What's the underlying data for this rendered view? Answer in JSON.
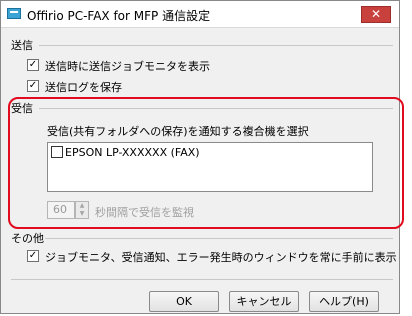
{
  "window": {
    "title": "Offirio PC-FAX for MFP 通信設定",
    "close_symbol": "✕"
  },
  "send_section": {
    "heading": "送信",
    "options": [
      {
        "label": "送信時に送信ジョブモニタを表示",
        "checked": true
      },
      {
        "label": "送信ログを保存",
        "checked": true
      }
    ]
  },
  "receive_section": {
    "heading": "受信",
    "list_label": "受信(共有フォルダへの保存)を通知する複合機を選択",
    "devices": [
      {
        "label": "EPSON LP-XXXXXX (FAX)",
        "checked": false
      }
    ],
    "interval_value": "60",
    "interval_label": "秒間隔で受信を監視"
  },
  "other_section": {
    "heading": "その他",
    "option": {
      "label": "ジョブモニタ、受信通知、エラー発生時のウィンドウを常に手前に表示",
      "checked": true
    }
  },
  "buttons": {
    "ok": "OK",
    "cancel": "キャンセル",
    "help": "ヘルプ(H)"
  },
  "check_mark": "✓",
  "colors": {
    "highlight_border": "#e10a1e",
    "close_button": "#c9413d"
  }
}
